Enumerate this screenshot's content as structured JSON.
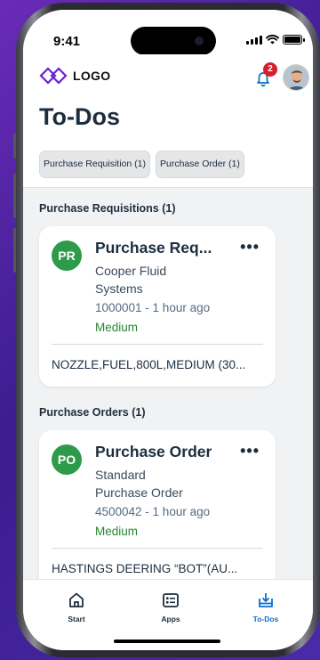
{
  "status": {
    "time": "9:41"
  },
  "header": {
    "logo_text": "LOGO",
    "notification_count": "2",
    "title": "To-Dos",
    "filters": [
      {
        "label": "Purchase Requisition (1)"
      },
      {
        "label": "Purchase Order (1)"
      }
    ]
  },
  "sections": [
    {
      "title": "Purchase Requisitions (1)",
      "card": {
        "avatar": "PR",
        "title": "Purchase Req...",
        "subtitle": "Cooper Fluid Systems",
        "meta": "1000001 - 1 hour ago",
        "priority": "Medium",
        "description": "NOZZLE,FUEL,800L,MEDIUM (30..."
      }
    },
    {
      "title": "Purchase Orders (1)",
      "card": {
        "avatar": "PO",
        "title": "Purchase Order",
        "subtitle": "Standard Purchase Order",
        "meta": "4500042 - 1 hour ago",
        "priority": "Medium",
        "description": "HASTINGS DEERING “BOT”(AU..."
      }
    }
  ],
  "tabbar": {
    "tabs": [
      {
        "label": "Start",
        "icon": "home-icon",
        "active": false
      },
      {
        "label": "Apps",
        "icon": "apps-icon",
        "active": false
      },
      {
        "label": "To-Dos",
        "icon": "todo-icon",
        "active": true
      }
    ]
  },
  "colors": {
    "accent": "#0a6ed1",
    "avatar_green": "#2e9b4a",
    "priority_green": "#25882f",
    "badge_red": "#d81e2c",
    "logo_purple": "#6a1fd1"
  }
}
